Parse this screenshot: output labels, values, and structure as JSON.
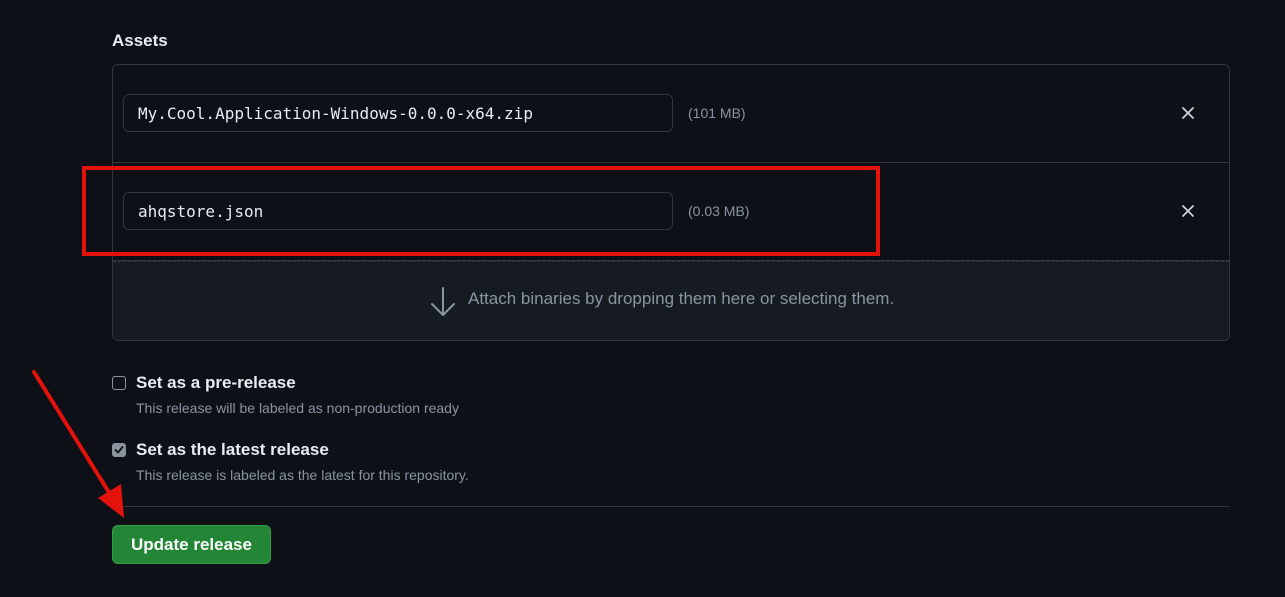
{
  "assets": {
    "heading": "Assets",
    "files": [
      {
        "name": "My.Cool.Application-Windows-0.0.0-x64.zip",
        "size": "(101 MB)",
        "remove_icon": "close-icon"
      },
      {
        "name": "ahqstore.json",
        "size": "(0.03 MB)",
        "remove_icon": "close-icon"
      }
    ],
    "dropzone": {
      "icon": "arrow-down-icon",
      "text": "Attach binaries by dropping them here or selecting them."
    }
  },
  "options": {
    "prerelease": {
      "label": "Set as a pre-release",
      "description": "This release will be labeled as non-production ready",
      "checked": false
    },
    "latest": {
      "label": "Set as the latest release",
      "description": "This release is labeled as the latest for this repository.",
      "checked": true
    }
  },
  "actions": {
    "update_label": "Update release"
  },
  "annotations": {
    "highlight_color": "#e3120b",
    "arrow_color": "#e3120b"
  },
  "colors": {
    "background": "#0d1117",
    "border": "#30363d",
    "button_green": "#238636"
  }
}
